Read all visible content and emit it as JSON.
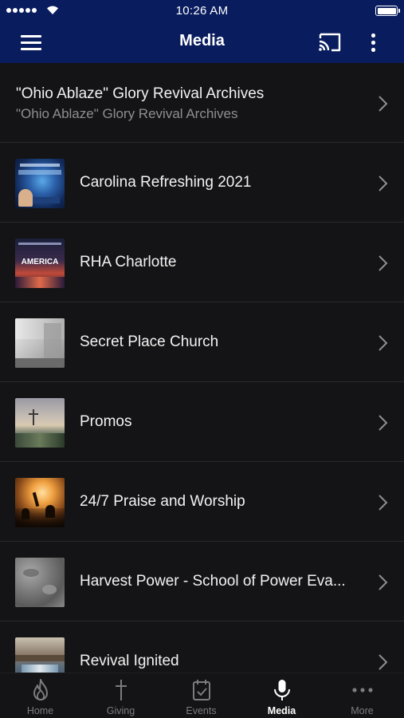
{
  "status_bar": {
    "time": "10:26 AM"
  },
  "nav": {
    "title": "Media"
  },
  "list": [
    {
      "title": "\"Ohio Ablaze\" Glory Revival Archives",
      "subtitle": "\"Ohio Ablaze\" Glory Revival Archives"
    },
    {
      "title": "Carolina Refreshing 2021",
      "thumb_text": ""
    },
    {
      "title": "RHA Charlotte",
      "thumb_text": "AMERICA"
    },
    {
      "title": "Secret Place Church"
    },
    {
      "title": "Promos"
    },
    {
      "title": "24/7 Praise and Worship"
    },
    {
      "title": "Harvest Power - School of Power Eva..."
    },
    {
      "title": "Revival Ignited"
    }
  ],
  "tabs": [
    {
      "label": "Home",
      "icon": "flame-icon",
      "active": false
    },
    {
      "label": "Giving",
      "icon": "cross-icon",
      "active": false
    },
    {
      "label": "Events",
      "icon": "calendar-check-icon",
      "active": false
    },
    {
      "label": "Media",
      "icon": "microphone-icon",
      "active": true
    },
    {
      "label": "More",
      "icon": "more-dots-icon",
      "active": false
    }
  ],
  "colors": {
    "nav_bg": "#091c5e",
    "list_bg": "#141416",
    "subtitle": "#8e8e93",
    "tab_inactive": "#7c7c80"
  }
}
